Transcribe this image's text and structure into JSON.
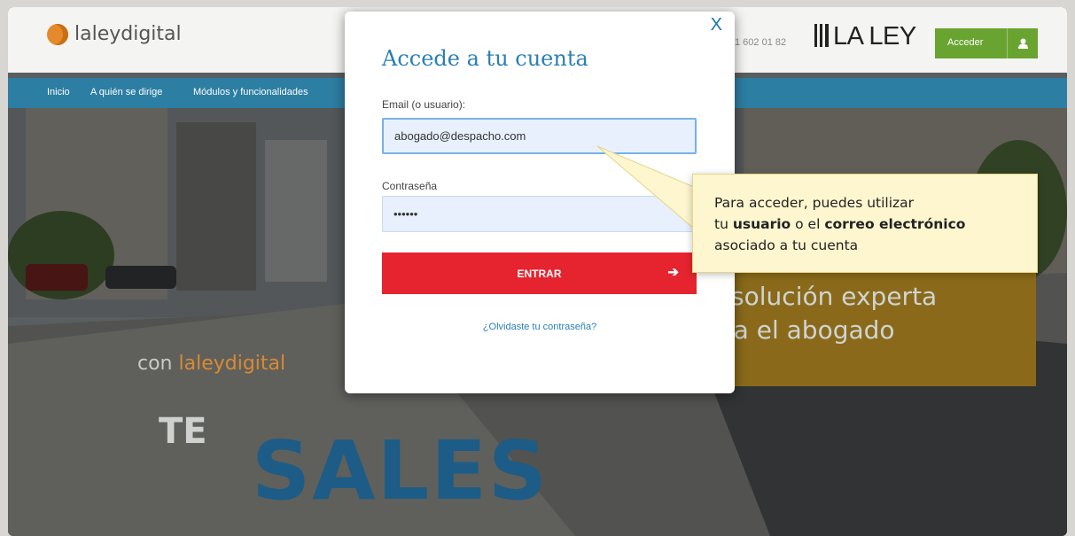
{
  "header": {
    "logo_text": "laleydigital",
    "phone": "1 602 01 82",
    "brand": "LA LEY",
    "acceder_label": "Acceder"
  },
  "nav": {
    "items": [
      {
        "label": "Inicio"
      },
      {
        "label": "A quién se dirige"
      },
      {
        "label": "Módulos y funcionalidades"
      }
    ]
  },
  "hero": {
    "headline_line1": "a solución experta",
    "headline_line2": "ara el abogado",
    "con_prefix": "con ",
    "con_brand": "laleydigital",
    "te": "TE",
    "sales": "SALES"
  },
  "modal": {
    "close_label": "X",
    "title": "Accede a tu cuenta",
    "email_label": "Email (o usuario):",
    "email_value": "abogado@despacho.com",
    "password_label": "Contraseña",
    "password_value": "••••••",
    "submit_label": "ENTRAR",
    "forgot_link": "¿Olvidaste tu contraseña?"
  },
  "tooltip": {
    "line1": "Para acceder, puedes utilizar",
    "line2_pre": "tu ",
    "line2_b1": "usuario",
    "line2_mid": " o el ",
    "line2_b2": "correo electrónico",
    "line3": "asociado a tu cuenta"
  },
  "colors": {
    "accent_blue": "#2a7fb5",
    "nav_blue": "#2d7ea3",
    "button_red": "#e5242f",
    "acceder_green": "#69a430",
    "tooltip_bg": "#fdf6cf",
    "logo_orange": "#e5892d"
  }
}
